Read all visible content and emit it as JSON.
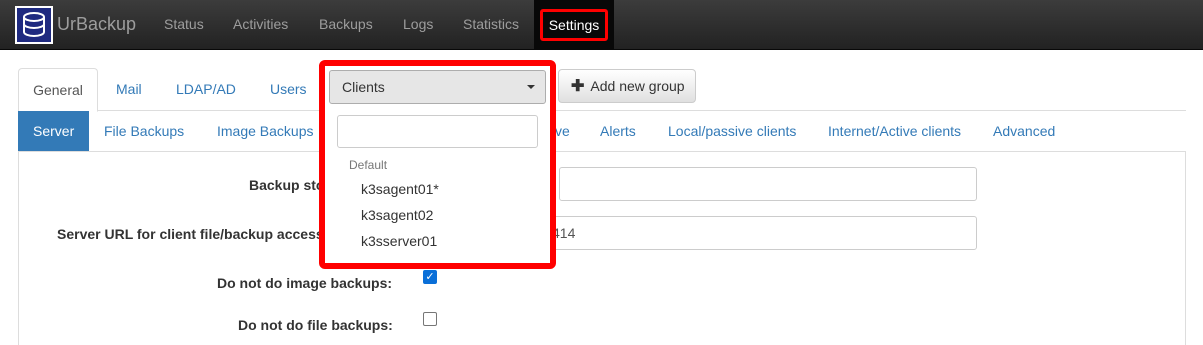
{
  "navbar": {
    "brand": "UrBackup",
    "items": [
      "Status",
      "Activities",
      "Backups",
      "Logs",
      "Statistics"
    ],
    "active": "Settings",
    "highlight_color": "#ff0000"
  },
  "tabs": {
    "items": [
      "General",
      "Mail",
      "LDAP/AD",
      "Users"
    ],
    "add_group_label": "Add new group"
  },
  "subtabs": {
    "active": "Server",
    "items": [
      "File Backups",
      "Image Backups",
      "ve",
      "Alerts",
      "Local/passive clients",
      "Internet/Active clients",
      "Advanced"
    ]
  },
  "settings": {
    "backup_storage_label": "Backup sto",
    "server_url_label": "Server URL for client file/backup access",
    "server_url_value": "414",
    "no_image_backups_label": "Do not do image backups:",
    "no_image_backups_checked": true,
    "no_file_backups_label": "Do not do file backups:",
    "no_file_backups_checked": false
  },
  "client_dropdown": {
    "selected": "Clients",
    "search_placeholder": "",
    "group_header": "Default",
    "options": [
      "k3sagent01*",
      "k3sagent02",
      "k3sserver01"
    ]
  }
}
